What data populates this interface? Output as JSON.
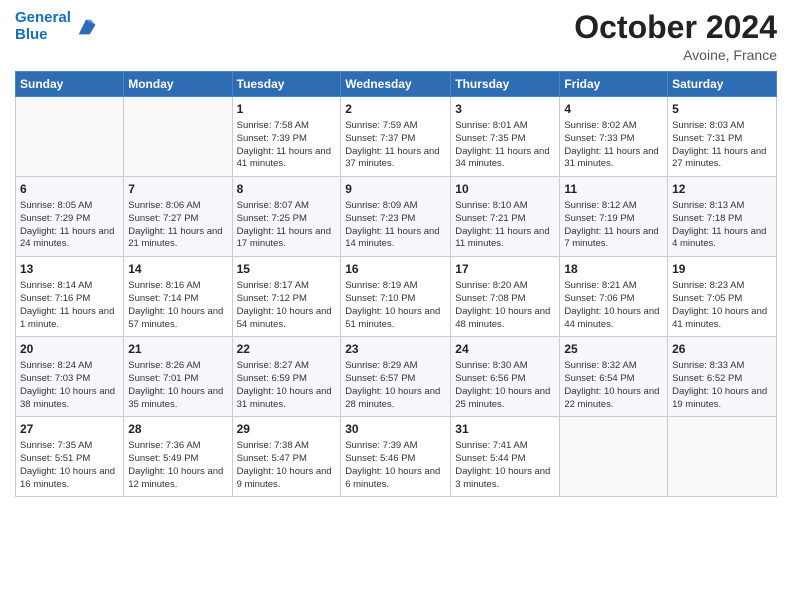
{
  "header": {
    "logo_line1": "General",
    "logo_line2": "Blue",
    "month": "October 2024",
    "location": "Avoine, France"
  },
  "days_of_week": [
    "Sunday",
    "Monday",
    "Tuesday",
    "Wednesday",
    "Thursday",
    "Friday",
    "Saturday"
  ],
  "weeks": [
    [
      {
        "day": "",
        "text": ""
      },
      {
        "day": "",
        "text": ""
      },
      {
        "day": "1",
        "text": "Sunrise: 7:58 AM\nSunset: 7:39 PM\nDaylight: 11 hours and 41 minutes."
      },
      {
        "day": "2",
        "text": "Sunrise: 7:59 AM\nSunset: 7:37 PM\nDaylight: 11 hours and 37 minutes."
      },
      {
        "day": "3",
        "text": "Sunrise: 8:01 AM\nSunset: 7:35 PM\nDaylight: 11 hours and 34 minutes."
      },
      {
        "day": "4",
        "text": "Sunrise: 8:02 AM\nSunset: 7:33 PM\nDaylight: 11 hours and 31 minutes."
      },
      {
        "day": "5",
        "text": "Sunrise: 8:03 AM\nSunset: 7:31 PM\nDaylight: 11 hours and 27 minutes."
      }
    ],
    [
      {
        "day": "6",
        "text": "Sunrise: 8:05 AM\nSunset: 7:29 PM\nDaylight: 11 hours and 24 minutes."
      },
      {
        "day": "7",
        "text": "Sunrise: 8:06 AM\nSunset: 7:27 PM\nDaylight: 11 hours and 21 minutes."
      },
      {
        "day": "8",
        "text": "Sunrise: 8:07 AM\nSunset: 7:25 PM\nDaylight: 11 hours and 17 minutes."
      },
      {
        "day": "9",
        "text": "Sunrise: 8:09 AM\nSunset: 7:23 PM\nDaylight: 11 hours and 14 minutes."
      },
      {
        "day": "10",
        "text": "Sunrise: 8:10 AM\nSunset: 7:21 PM\nDaylight: 11 hours and 11 minutes."
      },
      {
        "day": "11",
        "text": "Sunrise: 8:12 AM\nSunset: 7:19 PM\nDaylight: 11 hours and 7 minutes."
      },
      {
        "day": "12",
        "text": "Sunrise: 8:13 AM\nSunset: 7:18 PM\nDaylight: 11 hours and 4 minutes."
      }
    ],
    [
      {
        "day": "13",
        "text": "Sunrise: 8:14 AM\nSunset: 7:16 PM\nDaylight: 11 hours and 1 minute."
      },
      {
        "day": "14",
        "text": "Sunrise: 8:16 AM\nSunset: 7:14 PM\nDaylight: 10 hours and 57 minutes."
      },
      {
        "day": "15",
        "text": "Sunrise: 8:17 AM\nSunset: 7:12 PM\nDaylight: 10 hours and 54 minutes."
      },
      {
        "day": "16",
        "text": "Sunrise: 8:19 AM\nSunset: 7:10 PM\nDaylight: 10 hours and 51 minutes."
      },
      {
        "day": "17",
        "text": "Sunrise: 8:20 AM\nSunset: 7:08 PM\nDaylight: 10 hours and 48 minutes."
      },
      {
        "day": "18",
        "text": "Sunrise: 8:21 AM\nSunset: 7:06 PM\nDaylight: 10 hours and 44 minutes."
      },
      {
        "day": "19",
        "text": "Sunrise: 8:23 AM\nSunset: 7:05 PM\nDaylight: 10 hours and 41 minutes."
      }
    ],
    [
      {
        "day": "20",
        "text": "Sunrise: 8:24 AM\nSunset: 7:03 PM\nDaylight: 10 hours and 38 minutes."
      },
      {
        "day": "21",
        "text": "Sunrise: 8:26 AM\nSunset: 7:01 PM\nDaylight: 10 hours and 35 minutes."
      },
      {
        "day": "22",
        "text": "Sunrise: 8:27 AM\nSunset: 6:59 PM\nDaylight: 10 hours and 31 minutes."
      },
      {
        "day": "23",
        "text": "Sunrise: 8:29 AM\nSunset: 6:57 PM\nDaylight: 10 hours and 28 minutes."
      },
      {
        "day": "24",
        "text": "Sunrise: 8:30 AM\nSunset: 6:56 PM\nDaylight: 10 hours and 25 minutes."
      },
      {
        "day": "25",
        "text": "Sunrise: 8:32 AM\nSunset: 6:54 PM\nDaylight: 10 hours and 22 minutes."
      },
      {
        "day": "26",
        "text": "Sunrise: 8:33 AM\nSunset: 6:52 PM\nDaylight: 10 hours and 19 minutes."
      }
    ],
    [
      {
        "day": "27",
        "text": "Sunrise: 7:35 AM\nSunset: 5:51 PM\nDaylight: 10 hours and 16 minutes."
      },
      {
        "day": "28",
        "text": "Sunrise: 7:36 AM\nSunset: 5:49 PM\nDaylight: 10 hours and 12 minutes."
      },
      {
        "day": "29",
        "text": "Sunrise: 7:38 AM\nSunset: 5:47 PM\nDaylight: 10 hours and 9 minutes."
      },
      {
        "day": "30",
        "text": "Sunrise: 7:39 AM\nSunset: 5:46 PM\nDaylight: 10 hours and 6 minutes."
      },
      {
        "day": "31",
        "text": "Sunrise: 7:41 AM\nSunset: 5:44 PM\nDaylight: 10 hours and 3 minutes."
      },
      {
        "day": "",
        "text": ""
      },
      {
        "day": "",
        "text": ""
      }
    ]
  ]
}
